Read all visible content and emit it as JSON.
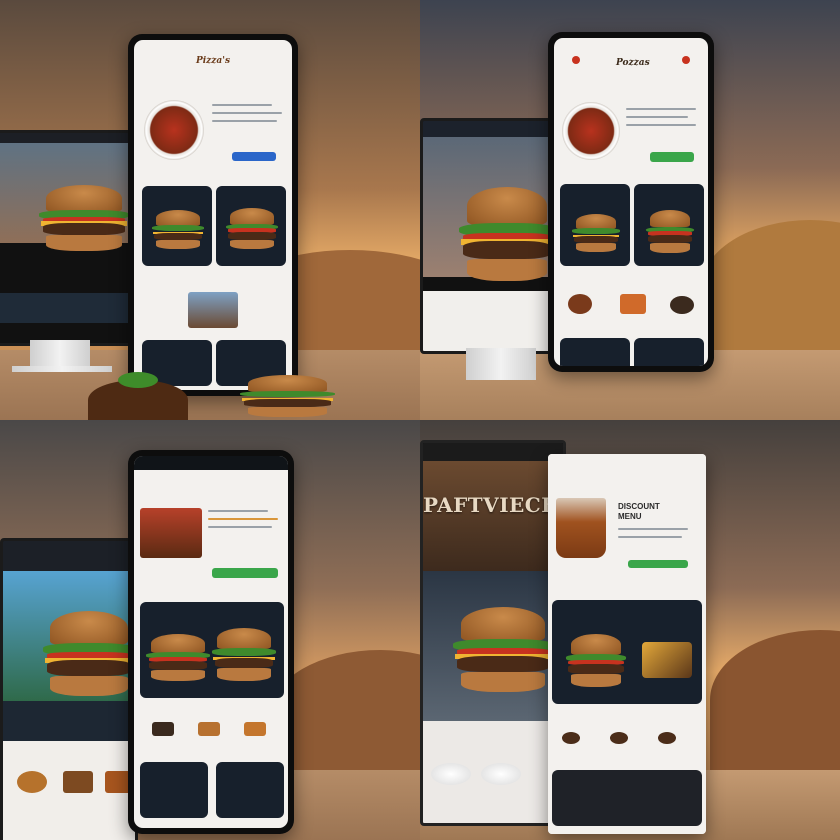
{
  "panels": [
    {
      "brand": "Pizza's"
    },
    {
      "brand": "Pozzas"
    },
    {
      "brand": ""
    },
    {
      "headline": "PAFTVIECEATEED",
      "subhead_line1": "DISCOUNT",
      "subhead_line2": "MENU"
    }
  ],
  "colors": {
    "accent_blue": "#2a66c9",
    "accent_green": "#3aa64a",
    "accent_orange": "#e6862b",
    "dark_card": "#17202c"
  }
}
